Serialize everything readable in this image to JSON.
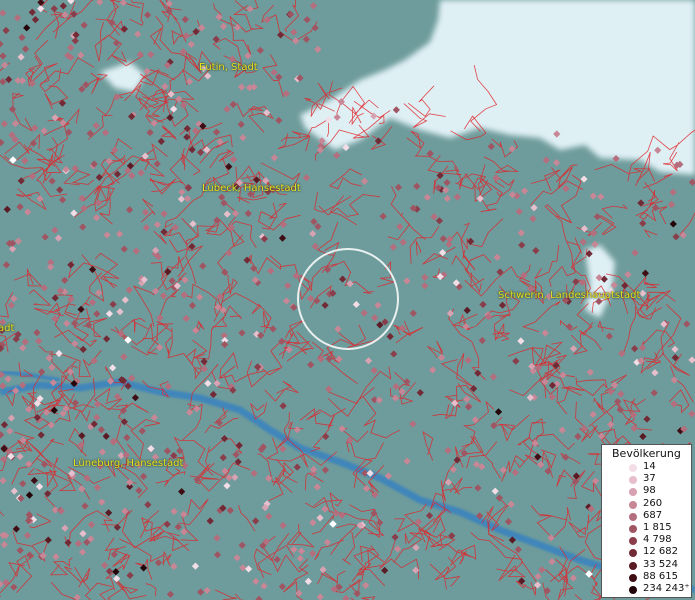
{
  "map": {
    "cities": [
      {
        "name": "Eutin, Stadt"
      },
      {
        "name": "Lübeck, Hansestadt"
      },
      {
        "name": "Schwerin, Landeshauptstadt"
      },
      {
        "name": "Lüneburg, Hansestadt"
      },
      {
        "name": "adt"
      }
    ],
    "colors": {
      "land": "#6e9b9b",
      "sea": "#dff0f5",
      "river": "#3f86bb",
      "borders": "#e0252a",
      "label": "#e6e61e",
      "selection_ring": "#ffffff"
    }
  },
  "legend": {
    "title": "Bevölkerung",
    "entries": [
      {
        "label": "14",
        "color": "#f3dde6"
      },
      {
        "label": "37",
        "color": "#e7bfcc"
      },
      {
        "label": "98",
        "color": "#d7a2b2"
      },
      {
        "label": "260",
        "color": "#c78796"
      },
      {
        "label": "687",
        "color": "#b56e7d"
      },
      {
        "label": "1 815",
        "color": "#a05563"
      },
      {
        "label": "4 798",
        "color": "#8a3e4b"
      },
      {
        "label": "12 682",
        "color": "#722a36"
      },
      {
        "label": "33 524",
        "color": "#5a1b24"
      },
      {
        "label": "88 615",
        "color": "#3f0e15"
      },
      {
        "label": "234 243⁺",
        "color": "#220409"
      }
    ]
  }
}
